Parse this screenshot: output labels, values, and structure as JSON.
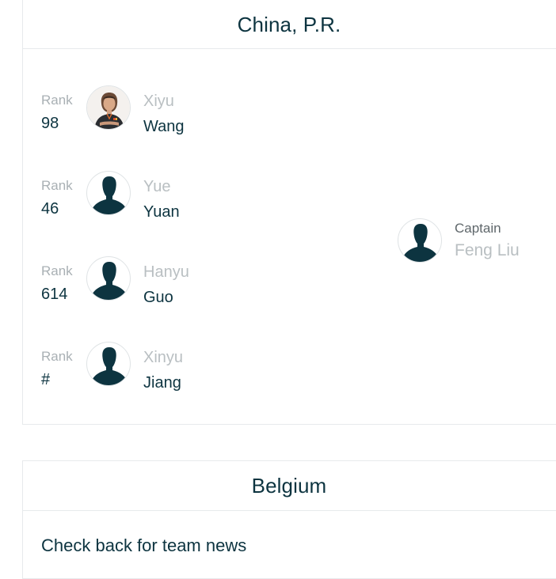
{
  "teams": [
    {
      "name": "China, P.R.",
      "players": [
        {
          "rank_label": "Rank",
          "rank": "98",
          "first": "Xiyu",
          "last": "Wang",
          "avatar": "player-photo"
        },
        {
          "rank_label": "Rank",
          "rank": "46",
          "first": "Yue",
          "last": "Yuan",
          "avatar": "silhouette"
        },
        {
          "rank_label": "Rank",
          "rank": "614",
          "first": "Hanyu",
          "last": "Guo",
          "avatar": "silhouette"
        },
        {
          "rank_label": "Rank",
          "rank": "#",
          "first": "Xinyu",
          "last": "Jiang",
          "avatar": "silhouette"
        }
      ],
      "captain": {
        "label": "Captain",
        "name": "Feng Liu",
        "avatar": "silhouette"
      }
    },
    {
      "name": "Belgium",
      "news": "Check back for team news"
    }
  ],
  "colors": {
    "primary_text": "#0d3440",
    "muted_text": "#b9bfc2",
    "rank_label": "#a9b0b4",
    "silhouette": "#0d3440",
    "border": "#e7eaec"
  }
}
